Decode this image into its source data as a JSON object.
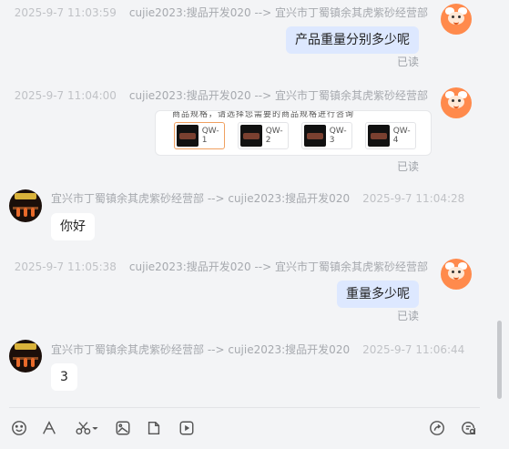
{
  "messages": [
    {
      "time": "2025-9-7 11:03:59",
      "route": "cujie2023:搜品开发020 --> 宜兴市丁蜀镇余其虎紫砂经营部",
      "text": "产品重量分别多少呢",
      "status": "已读"
    },
    {
      "time": "2025-9-7 11:04:00",
      "route": "cujie2023:搜品开发020 --> 宜兴市丁蜀镇余其虎紫砂经营部",
      "card_top_text": "商品规格，请选择您需要的商品规格进行咨询",
      "products": [
        "QW-1",
        "QW-2",
        "QW-3",
        "QW-4"
      ],
      "status": "已读"
    },
    {
      "time": "2025-9-7 11:04:28",
      "route": "宜兴市丁蜀镇余其虎紫砂经营部 --> cujie2023:搜品开发020",
      "text": "你好"
    },
    {
      "time": "2025-9-7 11:05:38",
      "route": "cujie2023:搜品开发020 --> 宜兴市丁蜀镇余其虎紫砂经营部",
      "text": "重量多少呢",
      "status": "已读"
    },
    {
      "time": "2025-9-7 11:06:44",
      "route": "宜兴市丁蜀镇余其虎紫砂经营部 --> cujie2023:搜品开发020",
      "text": "3"
    }
  ],
  "toolbar_icons": [
    "emoji-icon",
    "font-icon",
    "scissors-icon",
    "image-icon",
    "file-icon",
    "video-icon",
    "share-icon",
    "chat-settings-icon"
  ],
  "colors": {
    "mine_bubble": "#dde8ff",
    "theirs_bubble": "#ffffff",
    "background": "#f3f4f6",
    "avatar_orange": "#ff8a4c"
  }
}
